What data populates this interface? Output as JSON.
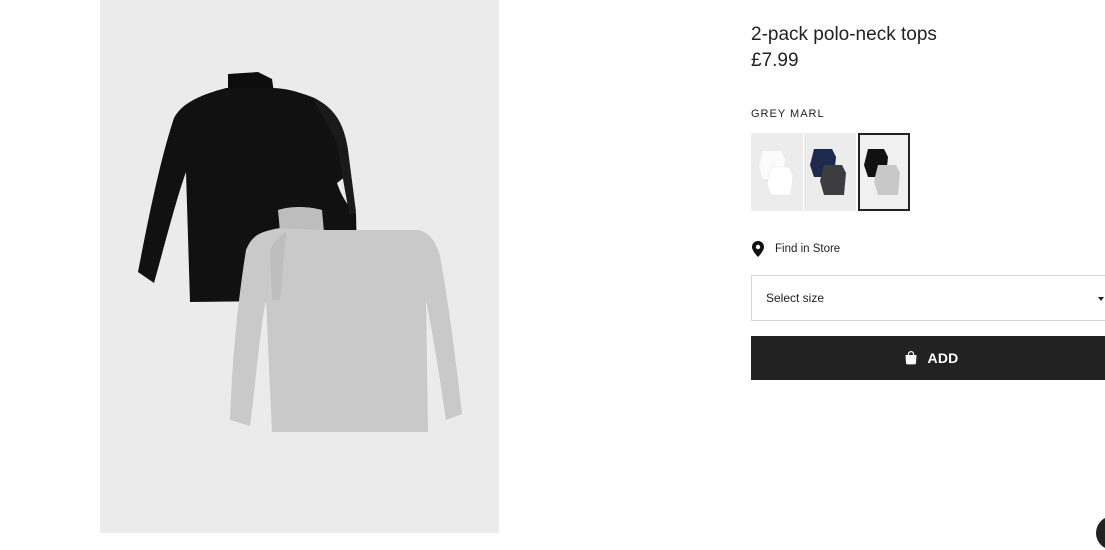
{
  "product": {
    "title": "2-pack polo-neck tops",
    "price": "£7.99",
    "selected_color": "GREY MARL",
    "image_alt": "Black and grey marl polo-neck tops"
  },
  "swatches": [
    {
      "name": "white",
      "colors": [
        "#ffffff",
        "#f4f4f4"
      ],
      "selected": false
    },
    {
      "name": "navy-dark-grey",
      "colors": [
        "#1d2a4d",
        "#3d3d40"
      ],
      "selected": false
    },
    {
      "name": "black-grey-marl",
      "colors": [
        "#111111",
        "#c8c8c8"
      ],
      "selected": true
    }
  ],
  "store": {
    "find_label": "Find in Store",
    "icon": "location-pin-icon"
  },
  "size_select": {
    "placeholder": "Select size",
    "icon": "caret-down-icon"
  },
  "add_button": {
    "label": "ADD",
    "icon": "shopping-bag-icon"
  },
  "colors": {
    "accent": "#222222",
    "image_bg": "#ebebeb",
    "black_top": "#111111",
    "grey_top": "#c9c9c9"
  }
}
